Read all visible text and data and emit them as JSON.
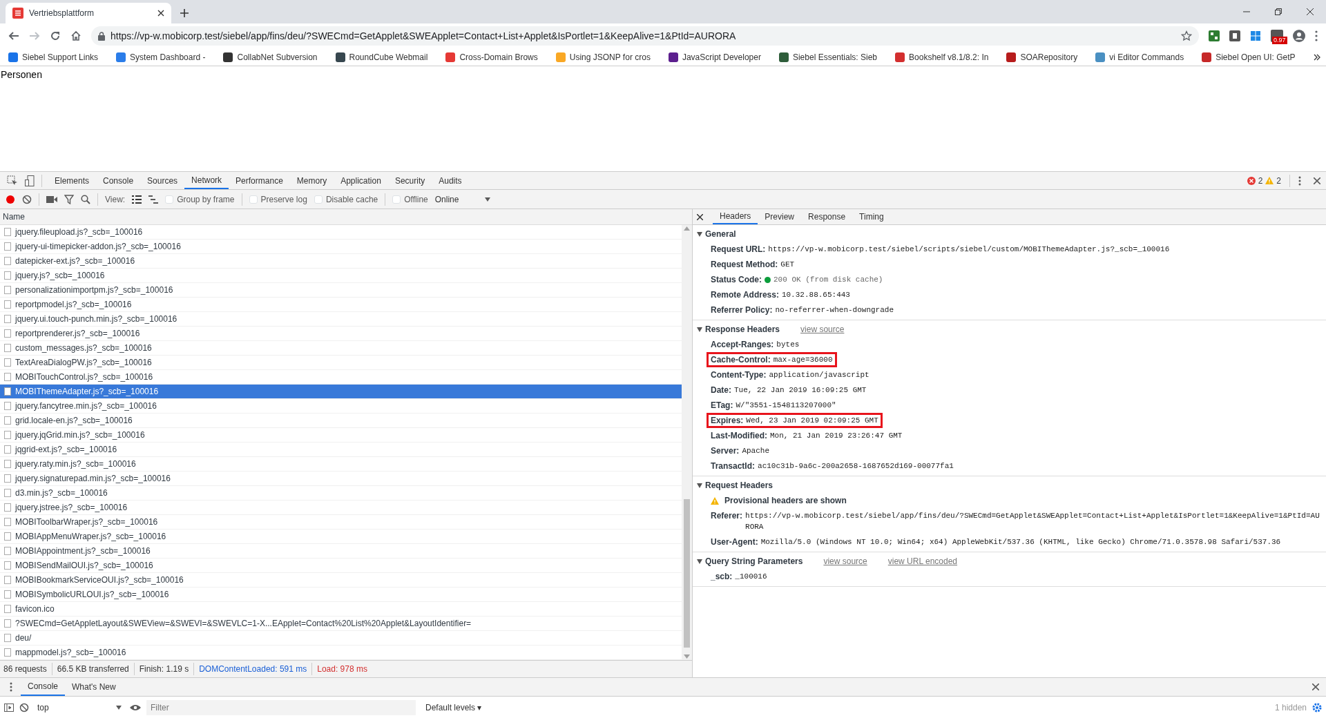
{
  "browser": {
    "tab": {
      "title": "Vertriebsplattform"
    },
    "address": "https://vp-w.mobicorp.test/siebel/app/fins/deu/?SWECmd=GetApplet&SWEApplet=Contact+List+Applet&IsPortlet=1&KeepAlive=1&PtId=AURORA",
    "extension_badge": "0.97",
    "bookmarks": [
      {
        "label": "Siebel Support Links",
        "color": "#1a73e8"
      },
      {
        "label": "System Dashboard -",
        "color": "#2b7de9"
      },
      {
        "label": "CollabNet Subversion",
        "color": "#333333"
      },
      {
        "label": "RoundCube Webmail",
        "color": "#37474f"
      },
      {
        "label": "Cross-Domain Brows",
        "color": "#e53935"
      },
      {
        "label": "Using JSONP for cros",
        "color": "#f9a825"
      },
      {
        "label": "JavaScript Developer",
        "color": "#5c1f8e"
      },
      {
        "label": "Siebel Essentials: Sieb",
        "color": "#2e5d3a"
      },
      {
        "label": "Bookshelf v8.1/8.2: In",
        "color": "#d32f2f"
      },
      {
        "label": "SOARepository",
        "color": "#b71c1c"
      },
      {
        "label": "vi Editor Commands",
        "color": "#4a90c2"
      },
      {
        "label": "Siebel Open UI: GetP",
        "color": "#c62828"
      }
    ]
  },
  "page": {
    "heading": "Personen"
  },
  "devtools": {
    "tabs": [
      {
        "label": "Elements",
        "selected": false
      },
      {
        "label": "Console",
        "selected": false
      },
      {
        "label": "Sources",
        "selected": false
      },
      {
        "label": "Network",
        "selected": true
      },
      {
        "label": "Performance",
        "selected": false
      },
      {
        "label": "Memory",
        "selected": false
      },
      {
        "label": "Application",
        "selected": false
      },
      {
        "label": "Security",
        "selected": false
      },
      {
        "label": "Audits",
        "selected": false
      }
    ],
    "error_count": "2",
    "warning_count": "2",
    "toolbar": {
      "view_label": "View:",
      "checkboxes": [
        {
          "label": "Group by frame",
          "checked": false
        },
        {
          "label": "Preserve log",
          "checked": false
        },
        {
          "label": "Disable cache",
          "checked": false
        },
        {
          "label": "Offline",
          "checked": false
        }
      ],
      "throttling": "Online"
    },
    "requests": {
      "column": "Name",
      "rows": [
        {
          "name": "jquery.fileupload.js?_scb=_100016",
          "selected": false
        },
        {
          "name": "jquery-ui-timepicker-addon.js?_scb=_100016",
          "selected": false
        },
        {
          "name": "datepicker-ext.js?_scb=_100016",
          "selected": false
        },
        {
          "name": "jquery.js?_scb=_100016",
          "selected": false
        },
        {
          "name": "personalizationimportpm.js?_scb=_100016",
          "selected": false
        },
        {
          "name": "reportpmodel.js?_scb=_100016",
          "selected": false
        },
        {
          "name": "jquery.ui.touch-punch.min.js?_scb=_100016",
          "selected": false
        },
        {
          "name": "reportprenderer.js?_scb=_100016",
          "selected": false
        },
        {
          "name": "custom_messages.js?_scb=_100016",
          "selected": false
        },
        {
          "name": "TextAreaDialogPW.js?_scb=_100016",
          "selected": false
        },
        {
          "name": "MOBITouchControl.js?_scb=_100016",
          "selected": false
        },
        {
          "name": "MOBIThemeAdapter.js?_scb=_100016",
          "selected": true
        },
        {
          "name": "jquery.fancytree.min.js?_scb=_100016",
          "selected": false
        },
        {
          "name": "grid.locale-en.js?_scb=_100016",
          "selected": false
        },
        {
          "name": "jquery.jqGrid.min.js?_scb=_100016",
          "selected": false
        },
        {
          "name": "jqgrid-ext.js?_scb=_100016",
          "selected": false
        },
        {
          "name": "jquery.raty.min.js?_scb=_100016",
          "selected": false
        },
        {
          "name": "jquery.signaturepad.min.js?_scb=_100016",
          "selected": false
        },
        {
          "name": "d3.min.js?_scb=_100016",
          "selected": false
        },
        {
          "name": "jquery.jstree.js?_scb=_100016",
          "selected": false
        },
        {
          "name": "MOBIToolbarWraper.js?_scb=_100016",
          "selected": false
        },
        {
          "name": "MOBIAppMenuWraper.js?_scb=_100016",
          "selected": false
        },
        {
          "name": "MOBIAppointment.js?_scb=_100016",
          "selected": false
        },
        {
          "name": "MOBISendMailOUI.js?_scb=_100016",
          "selected": false
        },
        {
          "name": "MOBIBookmarkServiceOUI.js?_scb=_100016",
          "selected": false
        },
        {
          "name": "MOBISymbolicURLOUI.js?_scb=_100016",
          "selected": false
        },
        {
          "name": "favicon.ico",
          "selected": false
        },
        {
          "name": "?SWECmd=GetAppletLayout&SWEView=&SWEVI=&SWEVLC=1-X...EApplet=Contact%20List%20Applet&LayoutIdentifier=",
          "selected": false
        },
        {
          "name": "deu/",
          "selected": false
        },
        {
          "name": "mappmodel.js?_scb=_100016",
          "selected": false
        }
      ]
    },
    "summary": [
      {
        "text": "86 requests",
        "kind": "plain"
      },
      {
        "text": "66.5 KB transferred",
        "kind": "plain"
      },
      {
        "text": "Finish: 1.19 s",
        "kind": "plain"
      },
      {
        "text": "DOMContentLoaded: 591 ms",
        "kind": "dom"
      },
      {
        "text": "Load: 978 ms",
        "kind": "load"
      }
    ],
    "detail_tabs": [
      {
        "label": "Headers",
        "selected": true
      },
      {
        "label": "Preview",
        "selected": false
      },
      {
        "label": "Response",
        "selected": false
      },
      {
        "label": "Timing",
        "selected": false
      }
    ],
    "sections": [
      {
        "title": "General",
        "expanded": true,
        "headers": [
          {
            "name": "Request URL:",
            "value": "https://vp-w.mobicorp.test/siebel/scripts/siebel/custom/MOBIThemeAdapter.js?_scb=_100016",
            "highlighted": false,
            "kind": "plain"
          },
          {
            "name": "Request Method:",
            "value": "GET",
            "highlighted": false,
            "kind": "plain"
          },
          {
            "name": "Status Code:",
            "value": "200 OK (from disk cache)",
            "highlighted": false,
            "kind": "status"
          },
          {
            "name": "Remote Address:",
            "value": "10.32.88.65:443",
            "highlighted": false,
            "kind": "plain"
          },
          {
            "name": "Referrer Policy:",
            "value": "no-referrer-when-downgrade",
            "highlighted": false,
            "kind": "plain"
          }
        ]
      },
      {
        "title": "Response Headers",
        "expanded": true,
        "links": [
          "view source"
        ],
        "headers": [
          {
            "name": "Accept-Ranges:",
            "value": "bytes",
            "highlighted": false,
            "kind": "plain"
          },
          {
            "name": "Cache-Control:",
            "value": "max-age=36000",
            "highlighted": true,
            "kind": "plain"
          },
          {
            "name": "Content-Type:",
            "value": "application/javascript",
            "highlighted": false,
            "kind": "plain"
          },
          {
            "name": "Date:",
            "value": "Tue, 22 Jan 2019 16:09:25 GMT",
            "highlighted": false,
            "kind": "plain"
          },
          {
            "name": "ETag:",
            "value": "W/\"3551-1548113207000\"",
            "highlighted": false,
            "kind": "plain"
          },
          {
            "name": "Expires:",
            "value": "Wed, 23 Jan 2019 02:09:25 GMT",
            "highlighted": true,
            "kind": "plain"
          },
          {
            "name": "Last-Modified:",
            "value": "Mon, 21 Jan 2019 23:26:47 GMT",
            "highlighted": false,
            "kind": "plain"
          },
          {
            "name": "Server:",
            "value": "Apache",
            "highlighted": false,
            "kind": "plain"
          },
          {
            "name": "TransactId:",
            "value": "ac10c31b-9a6c-200a2658-1687652d169-00077fa1",
            "highlighted": false,
            "kind": "plain"
          }
        ]
      },
      {
        "title": "Request Headers",
        "expanded": true,
        "notice": "Provisional headers are shown",
        "headers": [
          {
            "name": "Referer:",
            "value": "https://vp-w.mobicorp.test/siebel/app/fins/deu/?SWECmd=GetApplet&SWEApplet=Contact+List+Applet&IsPortlet=1&KeepAlive=1&PtId=AURORA",
            "highlighted": false,
            "kind": "plain"
          },
          {
            "name": "User-Agent:",
            "value": "Mozilla/5.0 (Windows NT 10.0; Win64; x64) AppleWebKit/537.36 (KHTML, like Gecko) Chrome/71.0.3578.98 Safari/537.36",
            "highlighted": false,
            "kind": "plain"
          }
        ]
      },
      {
        "title": "Query String Parameters",
        "expanded": true,
        "links": [
          "view source",
          "view URL encoded"
        ],
        "headers": [
          {
            "name": "_scb:",
            "value": "_100016",
            "highlighted": false,
            "kind": "plain"
          }
        ]
      }
    ]
  },
  "drawer": {
    "tabs": [
      {
        "label": "Console",
        "selected": true
      },
      {
        "label": "What's New",
        "selected": false
      }
    ],
    "context": "top",
    "filter_placeholder": "Filter",
    "levels": "Default levels ▾",
    "hidden_count": "1 hidden"
  }
}
